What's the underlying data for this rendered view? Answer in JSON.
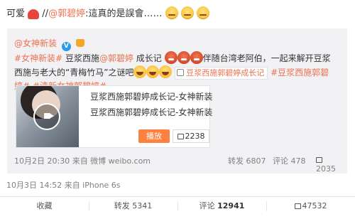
{
  "post": {
    "prefix": "可爱",
    "separator": " //",
    "mention": "@郭碧婷",
    "text": ":這真的是誤會……"
  },
  "quote": {
    "author": "@女神新装",
    "hashtag": "#女神新装#",
    "body_1": " 豆浆西施",
    "mention": "@郭碧婷",
    "body_2": " 成长记",
    "body_3": "伴随台湾老阿伯，一起来解开豆浆西施与老大的“青梅竹马”之谜吧",
    "video_link": "豆浆西施郭碧婷成长记",
    "tag_1": "#豆浆西施郭碧婷#",
    "tag_2": "#清新女神郭碧婷#",
    "card": {
      "title": "豆浆西施郭碧婷成长记-女神新装",
      "subtitle": "豆浆西施郭碧婷成长记-女神新装",
      "play_label": "播放",
      "likes": "2238"
    },
    "footer": {
      "time_source": "10月2日 20:30 来自 微博 weibo.com",
      "repost": "转发 6807",
      "comment": "评论 478",
      "likes": "2035"
    }
  },
  "meta": {
    "time_source": "10月3日 14:52 来自 iPhone 6s"
  },
  "actions": {
    "favorite": "收藏",
    "repost": "转发 5341",
    "comment_label": "评论 ",
    "comment_count": "12941",
    "likes": "47532"
  },
  "colors": {
    "accent": "#eb7350",
    "link": "#eb7350",
    "play": "#ff8140"
  }
}
